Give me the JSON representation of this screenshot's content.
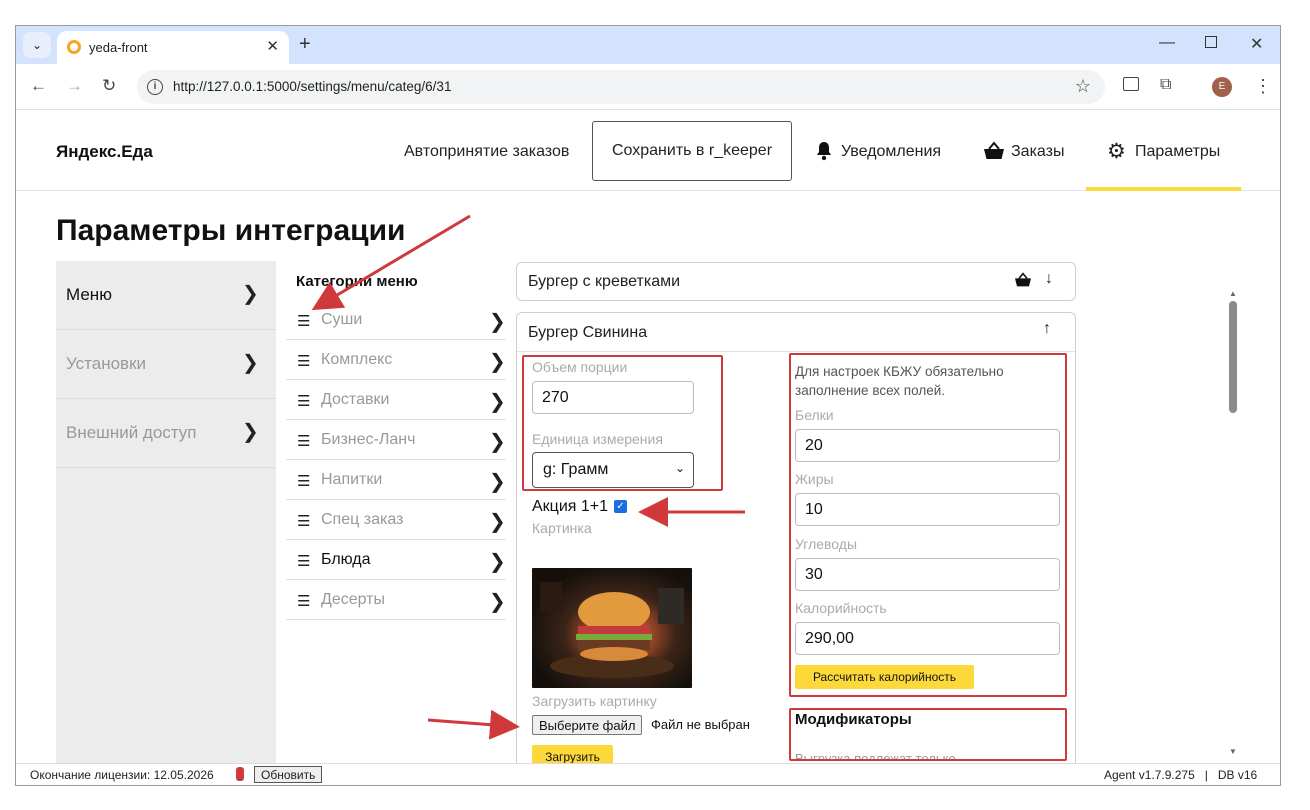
{
  "browser": {
    "tab_title": "yeda-front",
    "url": "http://127.0.0.1:5000/settings/menu/categ/6/31",
    "profile_initial": "E"
  },
  "header": {
    "brand": "Яндекс.Еда",
    "auto_accept": "Автопринятие заказов",
    "save_button": "Сохранить в r_keeper",
    "notifications": "Уведомления",
    "orders": "Заказы",
    "parameters": "Параметры"
  },
  "page_title": "Параметры интеграции",
  "sidebar": {
    "items": [
      {
        "label": "Меню"
      },
      {
        "label": "Установки"
      },
      {
        "label": "Внешний доступ"
      }
    ]
  },
  "categories": {
    "title": "Категории меню",
    "items": [
      {
        "label": "Суши"
      },
      {
        "label": "Комплекс"
      },
      {
        "label": "Доставки"
      },
      {
        "label": "Бизнес-Ланч"
      },
      {
        "label": "Напитки"
      },
      {
        "label": "Спец заказ"
      },
      {
        "label": "Блюда"
      },
      {
        "label": "Десерты"
      }
    ]
  },
  "dish_collapsed": {
    "name": "Бургер с креветками"
  },
  "dish": {
    "name": "Бургер Свинина",
    "portion_label": "Объем порции",
    "portion_value": "270",
    "unit_label": "Единица измерения",
    "unit_value": "g: Грамм",
    "promo_label": "Акция 1+1",
    "promo_checked": true,
    "picture_label": "Картинка",
    "upload_picture_label": "Загрузить картинку",
    "choose_file": "Выберите файл",
    "no_file": "Файл не выбран",
    "upload_button": "Загрузить",
    "kbju_note": "Для настроек КБЖУ обязательно заполнение всех полей.",
    "proteins_label": "Белки",
    "proteins_value": "20",
    "fats_label": "Жиры",
    "fats_value": "10",
    "carbs_label": "Углеводы",
    "carbs_value": "30",
    "calories_label": "Калорийность",
    "calories_value": "290,00",
    "calc_button": "Рассчитать калорийность",
    "modifiers_title": "Модификаторы",
    "modifiers_note": "Выгрузка подлежат только"
  },
  "statusbar": {
    "license": "Окончание лицензии: 12.05.2026",
    "refresh": "Обновить",
    "version": "Agent v1.7.9.275   |   DB v16"
  },
  "colors": {
    "accent_yellow": "#fcd83a",
    "annotation_red": "#d0393b",
    "sidebar_bg": "#ececec"
  }
}
